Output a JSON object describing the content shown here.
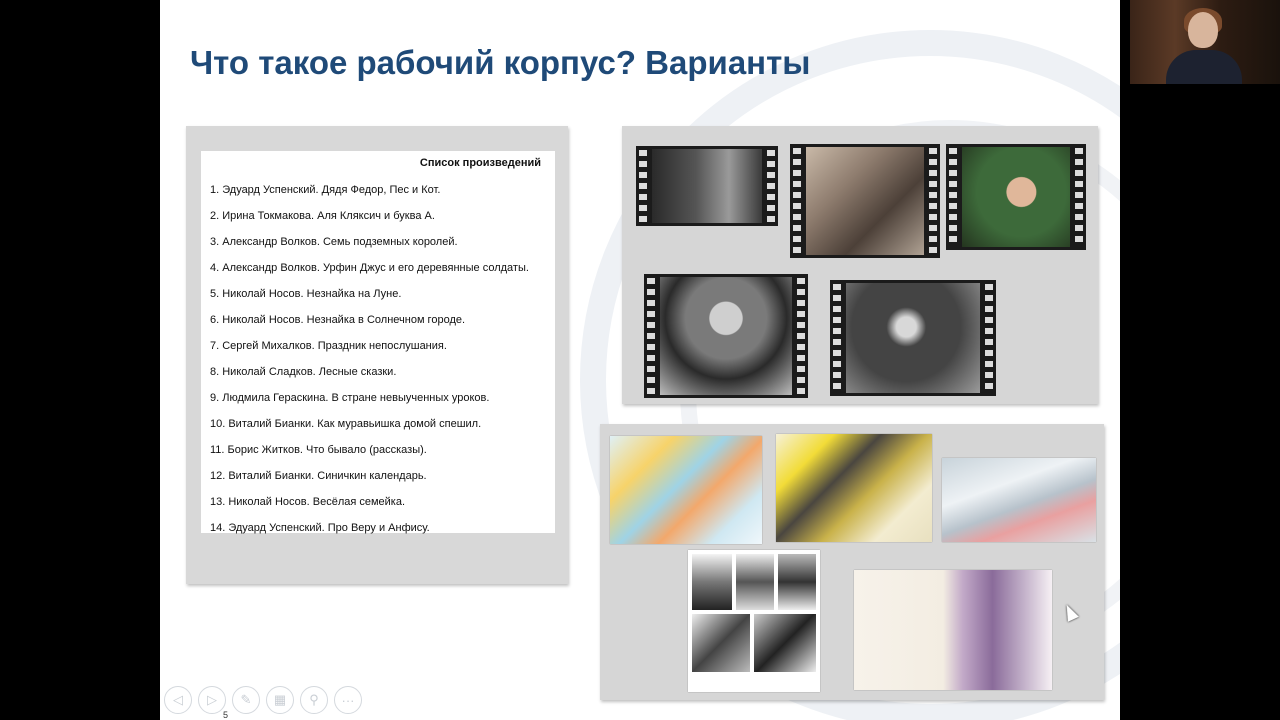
{
  "slide": {
    "title": "Что такое рабочий корпус? Варианты",
    "page_number": "5"
  },
  "works_list": {
    "heading": "Список произведений",
    "items": [
      "1. Эдуард Успенский. Дядя Федор, Пес и Кот.",
      "2. Ирина Токмакова. Аля Кляксич и буква А.",
      "3. Александр Волков. Семь подземных королей.",
      "4. Александр Волков. Урфин Джус и его деревянные солдаты.",
      "5. Николай Носов. Незнайка на Луне.",
      "6. Николай Носов. Незнайка в Солнечном городе.",
      "7. Сергей Михалков. Праздник непослушания.",
      "8. Николай Сладков. Лесные сказки.",
      "9. Людмила Гераскина. В стране невыученных уроков.",
      "10. Виталий Бианки. Как муравьишка домой спешил.",
      "11. Борис Житков. Что бывало (рассказы).",
      "12. Виталий Бианки. Синичкин календарь.",
      "13. Николай Носов. Весёлая семейка.",
      "14. Эдуард Успенский. Про Веру и Анфису."
    ]
  },
  "toolbar": {
    "prev_icon": "◁",
    "next_icon": "▷",
    "pen_icon": "✎",
    "slides_icon": "▦",
    "zoom_icon": "⚲",
    "more_icon": "···"
  },
  "colors": {
    "title": "#1f4a78",
    "panel": "#d6d6d6"
  }
}
